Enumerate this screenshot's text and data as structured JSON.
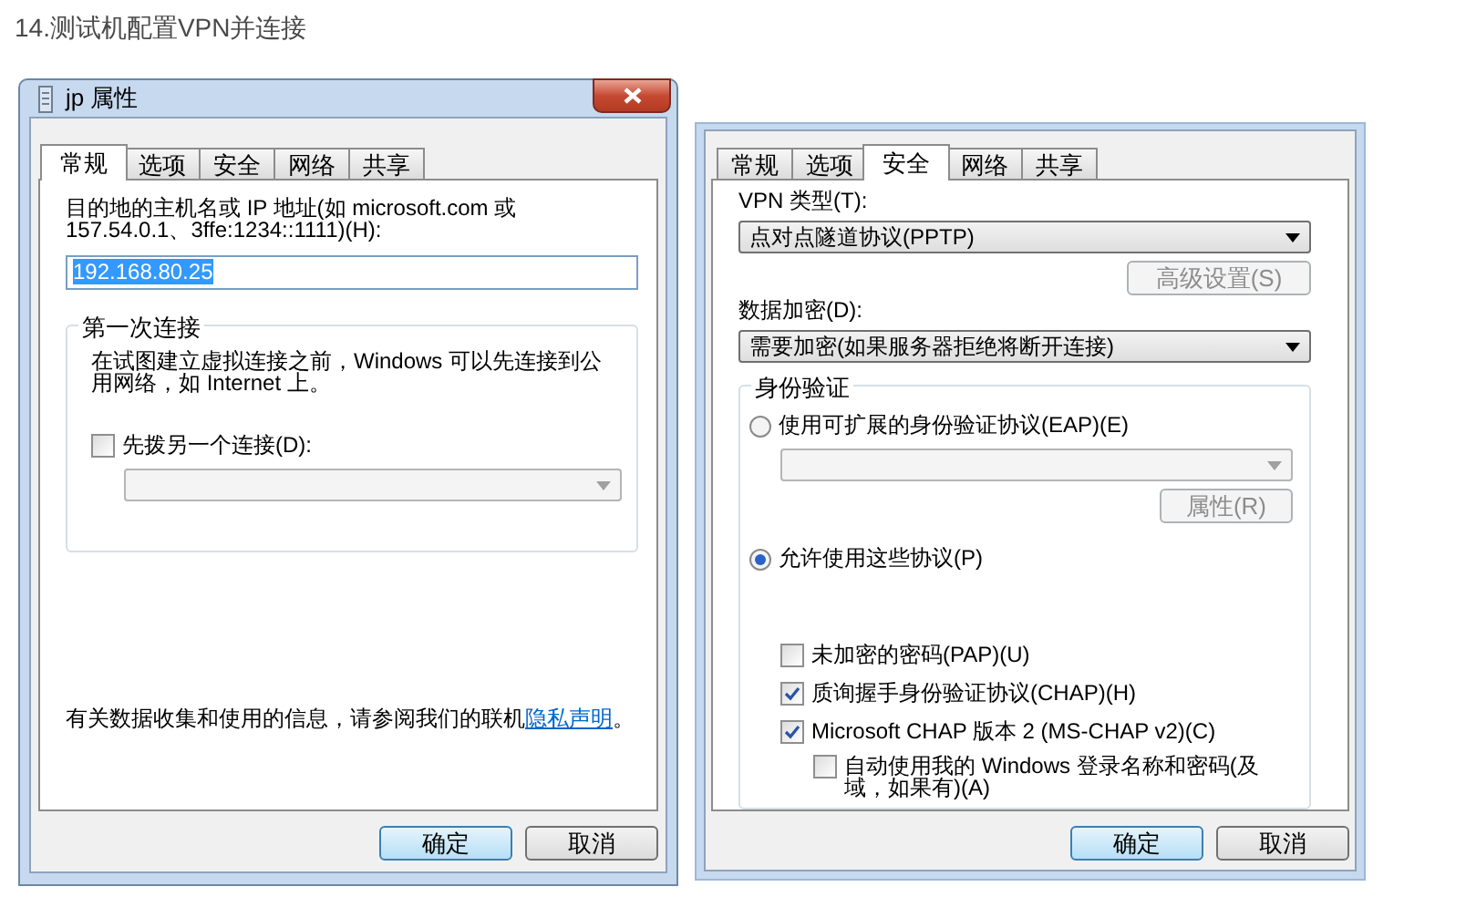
{
  "heading": "14.测试机配置VPN并连接",
  "general_dialog": {
    "title": "jp 属性",
    "tabs": [
      {
        "label": "常规",
        "selected": true
      },
      {
        "label": "选项",
        "selected": false
      },
      {
        "label": "安全",
        "selected": false
      },
      {
        "label": "网络",
        "selected": false
      },
      {
        "label": "共享",
        "selected": false
      }
    ],
    "host_label": "目的地的主机名或 IP 地址(如 microsoft.com 或 157.54.0.1、3ffe:1234::1111)(H):",
    "host_value": "192.168.80.25",
    "host_value_highlighted": true,
    "first_connection": {
      "legend": "第一次连接",
      "description": "在试图建立虚拟连接之前，Windows 可以先连接到公用网络，如 Internet 上。",
      "dial_first": {
        "label": "先拨另一个连接(D):",
        "checked": false
      },
      "dropdown_disabled": true
    },
    "privacy": {
      "text": "有关数据收集和使用的信息，请参阅我们的联机",
      "link": "隐私声明",
      "end": "。"
    },
    "buttons": [
      {
        "label": "确定",
        "default": true
      },
      {
        "label": "取消",
        "default": false
      }
    ]
  },
  "security_dialog": {
    "tabs": [
      {
        "label": "常规",
        "selected": false
      },
      {
        "label": "选项",
        "selected": false
      },
      {
        "label": "安全",
        "selected": true
      },
      {
        "label": "网络",
        "selected": false
      },
      {
        "label": "共享",
        "selected": false
      }
    ],
    "vpn_type_label": "VPN 类型(T):",
    "vpn_type": "点对点隧道协议(PPTP)",
    "advanced_button": {
      "label": "高级设置(S)",
      "disabled": true
    },
    "encryption_label": "数据加密(D):",
    "encryption": "需要加密(如果服务器拒绝将断开连接)",
    "authentication": {
      "legend": "身份验证",
      "eap": {
        "label": "使用可扩展的身份验证协议(EAP)(E)",
        "selected": false
      },
      "eap_dropdown_disabled": true,
      "properties_button": {
        "label": "属性(R)",
        "disabled": true
      },
      "allow": {
        "label": "允许使用这些协议(P)",
        "selected": true
      },
      "protocols": [
        {
          "label": "未加密的密码(PAP)(U)",
          "checked": false,
          "disabled": false
        },
        {
          "label": "质询握手身份验证协议(CHAP)(H)",
          "checked": true,
          "disabled": false
        },
        {
          "label": "Microsoft CHAP 版本 2 (MS-CHAP v2)(C)",
          "checked": true,
          "disabled": false,
          "children": [
            {
              "label": "自动使用我的 Windows 登录名称和密码(及域，如果有)(A)",
              "checked": false,
              "disabled": false
            }
          ]
        }
      ]
    },
    "buttons": [
      {
        "label": "确定",
        "default": true
      },
      {
        "label": "取消",
        "default": false
      }
    ]
  }
}
